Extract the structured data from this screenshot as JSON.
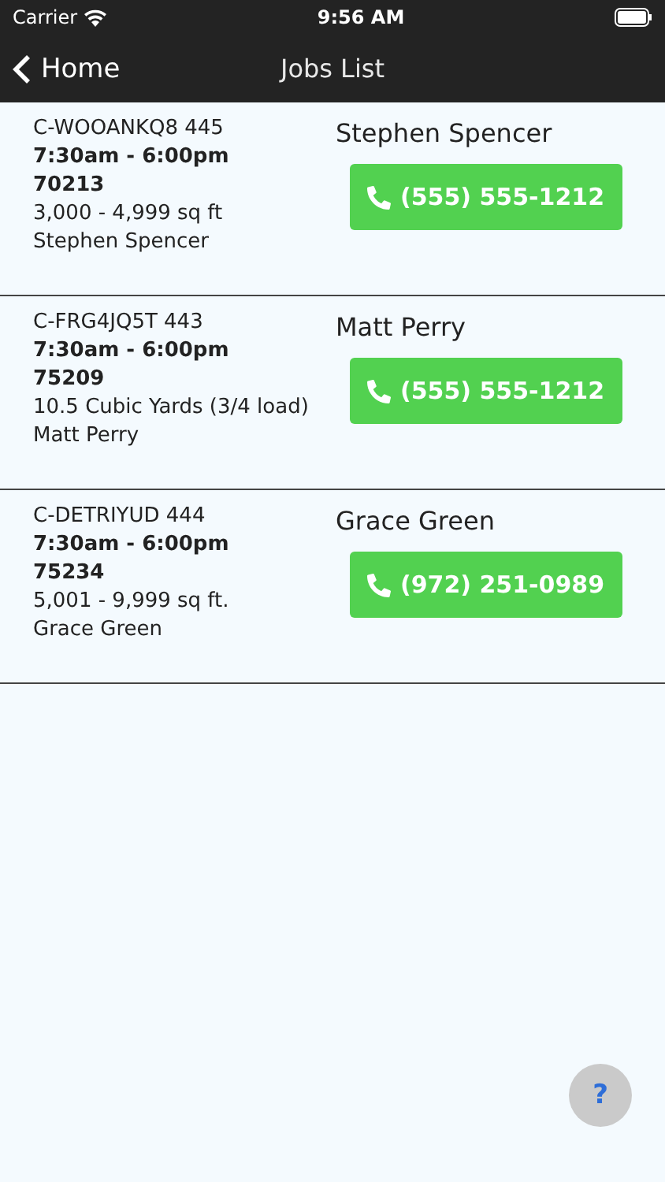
{
  "status_bar": {
    "carrier": "Carrier",
    "time": "9:56 AM"
  },
  "nav": {
    "back": "Home",
    "title": "Jobs List"
  },
  "jobs": [
    {
      "code": "C-WOOANKQ8 445",
      "hours": "7:30am - 6:00pm",
      "zip": "70213",
      "size": "3,000 - 4,999 sq ft",
      "customer": "Stephen Spencer",
      "contact": "Stephen Spencer",
      "phone": "(555) 555-1212"
    },
    {
      "code": "C-FRG4JQ5T 443",
      "hours": "7:30am - 6:00pm",
      "zip": "75209",
      "size": "10.5 Cubic Yards (3/4 load)",
      "customer": "Matt Perry",
      "contact": "Matt Perry",
      "phone": "(555) 555-1212"
    },
    {
      "code": "C-DETRIYUD 444",
      "hours": "7:30am - 6:00pm",
      "zip": "75234",
      "size": "5,001 - 9,999 sq ft.",
      "customer": "Grace Green",
      "contact": "Grace Green",
      "phone": "(972) 251-0989"
    }
  ],
  "help_button": "?"
}
